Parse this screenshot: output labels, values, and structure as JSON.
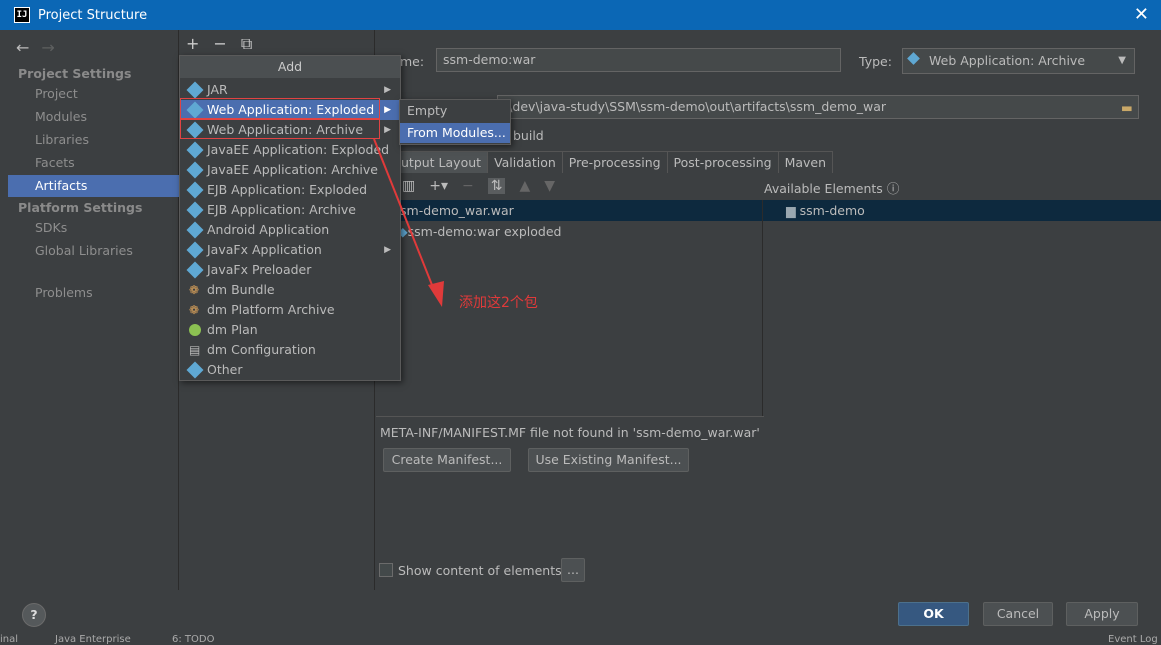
{
  "window": {
    "title": "Project Structure",
    "app_icon_text": "IJ"
  },
  "sidebar": {
    "project_settings_header": "Project Settings",
    "project_items": [
      {
        "label": "Project"
      },
      {
        "label": "Modules"
      },
      {
        "label": "Libraries"
      },
      {
        "label": "Facets"
      },
      {
        "label": "Artifacts",
        "selected": true
      }
    ],
    "platform_settings_header": "Platform Settings",
    "platform_items": [
      {
        "label": "SDKs"
      },
      {
        "label": "Global Libraries"
      }
    ],
    "problems": "Problems"
  },
  "artifact": {
    "name_label": "me:",
    "name_value": "ssm-demo:war",
    "type_label": "Type:",
    "type_value": "Web Application: Archive",
    "output_path": ":\\dev\\java-study\\SSM\\ssm-demo\\out\\artifacts\\ssm_demo_war",
    "build_label": "build",
    "tabs": [
      {
        "label": "utput Layout",
        "active": true
      },
      {
        "label": "Validation"
      },
      {
        "label": "Pre-processing"
      },
      {
        "label": "Post-processing"
      },
      {
        "label": "Maven"
      }
    ],
    "available_elements_label": "Available Elements",
    "tree_root": "sm-demo_war.war",
    "tree_child": "ssm-demo:war exploded",
    "available_root": "ssm-demo",
    "manifest_message": "META-INF/MANIFEST.MF file not found in 'ssm-demo_war.war'",
    "create_manifest": "Create Manifest...",
    "use_existing_manifest": "Use Existing Manifest...",
    "show_content_label": "Show content of elements",
    "more_button": "..."
  },
  "add_menu": {
    "header": "Add",
    "items": [
      {
        "label": "JAR",
        "submenu": true
      },
      {
        "label": "Web Application: Exploded",
        "submenu": true,
        "highlighted": true
      },
      {
        "label": "Web Application: Archive",
        "submenu": true
      },
      {
        "label": "JavaEE Application: Exploded"
      },
      {
        "label": "JavaEE Application: Archive"
      },
      {
        "label": "EJB Application: Exploded"
      },
      {
        "label": "EJB Application: Archive"
      },
      {
        "label": "Android Application"
      },
      {
        "label": "JavaFx Application",
        "submenu": true
      },
      {
        "label": "JavaFx Preloader"
      },
      {
        "label": "dm Bundle"
      },
      {
        "label": "dm Platform Archive"
      },
      {
        "label": "dm Plan"
      },
      {
        "label": "dm Configuration"
      },
      {
        "label": "Other"
      }
    ]
  },
  "submenu": {
    "items": [
      {
        "label": "Empty"
      },
      {
        "label": "From Modules...",
        "highlighted": true
      }
    ]
  },
  "annotation": {
    "text": "添加这2个包",
    "color": "#e03a3a"
  },
  "dialog_buttons": {
    "ok": "OK",
    "cancel": "Cancel",
    "apply": "Apply"
  },
  "help": "?",
  "statusbar": {
    "left": "inal",
    "java_enterprise": "Java Enterprise",
    "todo": "6: TODO",
    "event_log": "Event Log"
  },
  "colors": {
    "accent": "#4b6eaf",
    "titlebar": "#0b67b5",
    "background": "#3c3f41"
  }
}
